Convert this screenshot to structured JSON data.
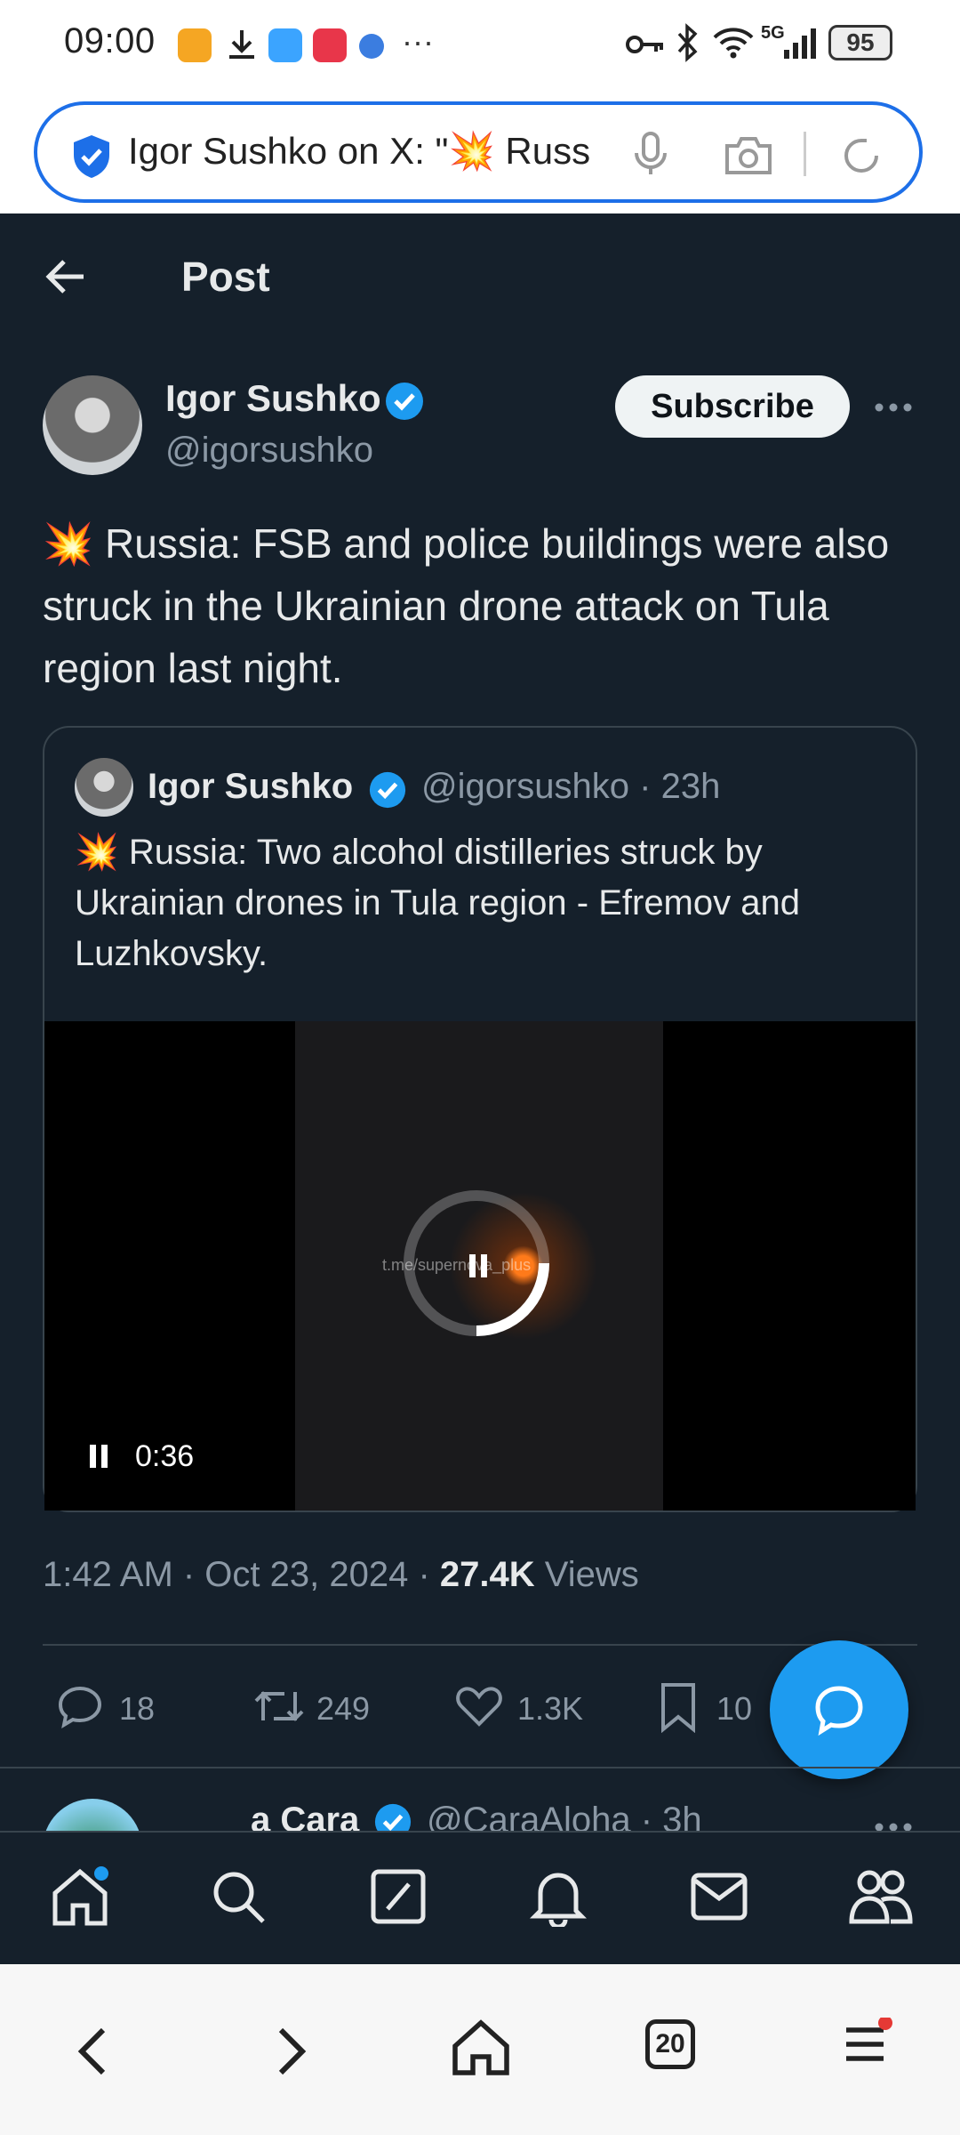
{
  "status_bar": {
    "time": "09:00",
    "more": "···",
    "network": "5G",
    "battery": "95"
  },
  "browser": {
    "url_text": "Igor Sushko on X: \"💥 Russ"
  },
  "header": {
    "title": "Post"
  },
  "post": {
    "author_name": "Igor Sushko",
    "author_handle": "@igorsushko",
    "subscribe_label": "Subscribe",
    "text": "💥 Russia: FSB and police buildings were also struck in the Ukrainian drone attack on Tula region last night.",
    "time": "1:42 AM · Oct 23, 2024 · ",
    "views_count": "27.4K",
    "views_label": " Views",
    "replies": "18",
    "reposts": "249",
    "likes": "1.3K",
    "bookmarks": "10"
  },
  "quoted": {
    "author_name": "Igor Sushko",
    "meta": "@igorsushko · 23h",
    "text": "💥 Russia: Two alcohol distilleries struck by Ukrainian drones in Tula region - Efremov and Luzhkovsky.",
    "video_duration": "0:36",
    "video_watermark": "t.me/supernova_plus"
  },
  "next_post": {
    "author_name": "a Cara",
    "meta": "@CaraAloha · 3h"
  },
  "browser_nav": {
    "tab_count": "20"
  },
  "colors": {
    "background": "#15202b",
    "accent": "#1d9bf0",
    "text": "#e7e9ea",
    "muted": "#8b98a5"
  }
}
